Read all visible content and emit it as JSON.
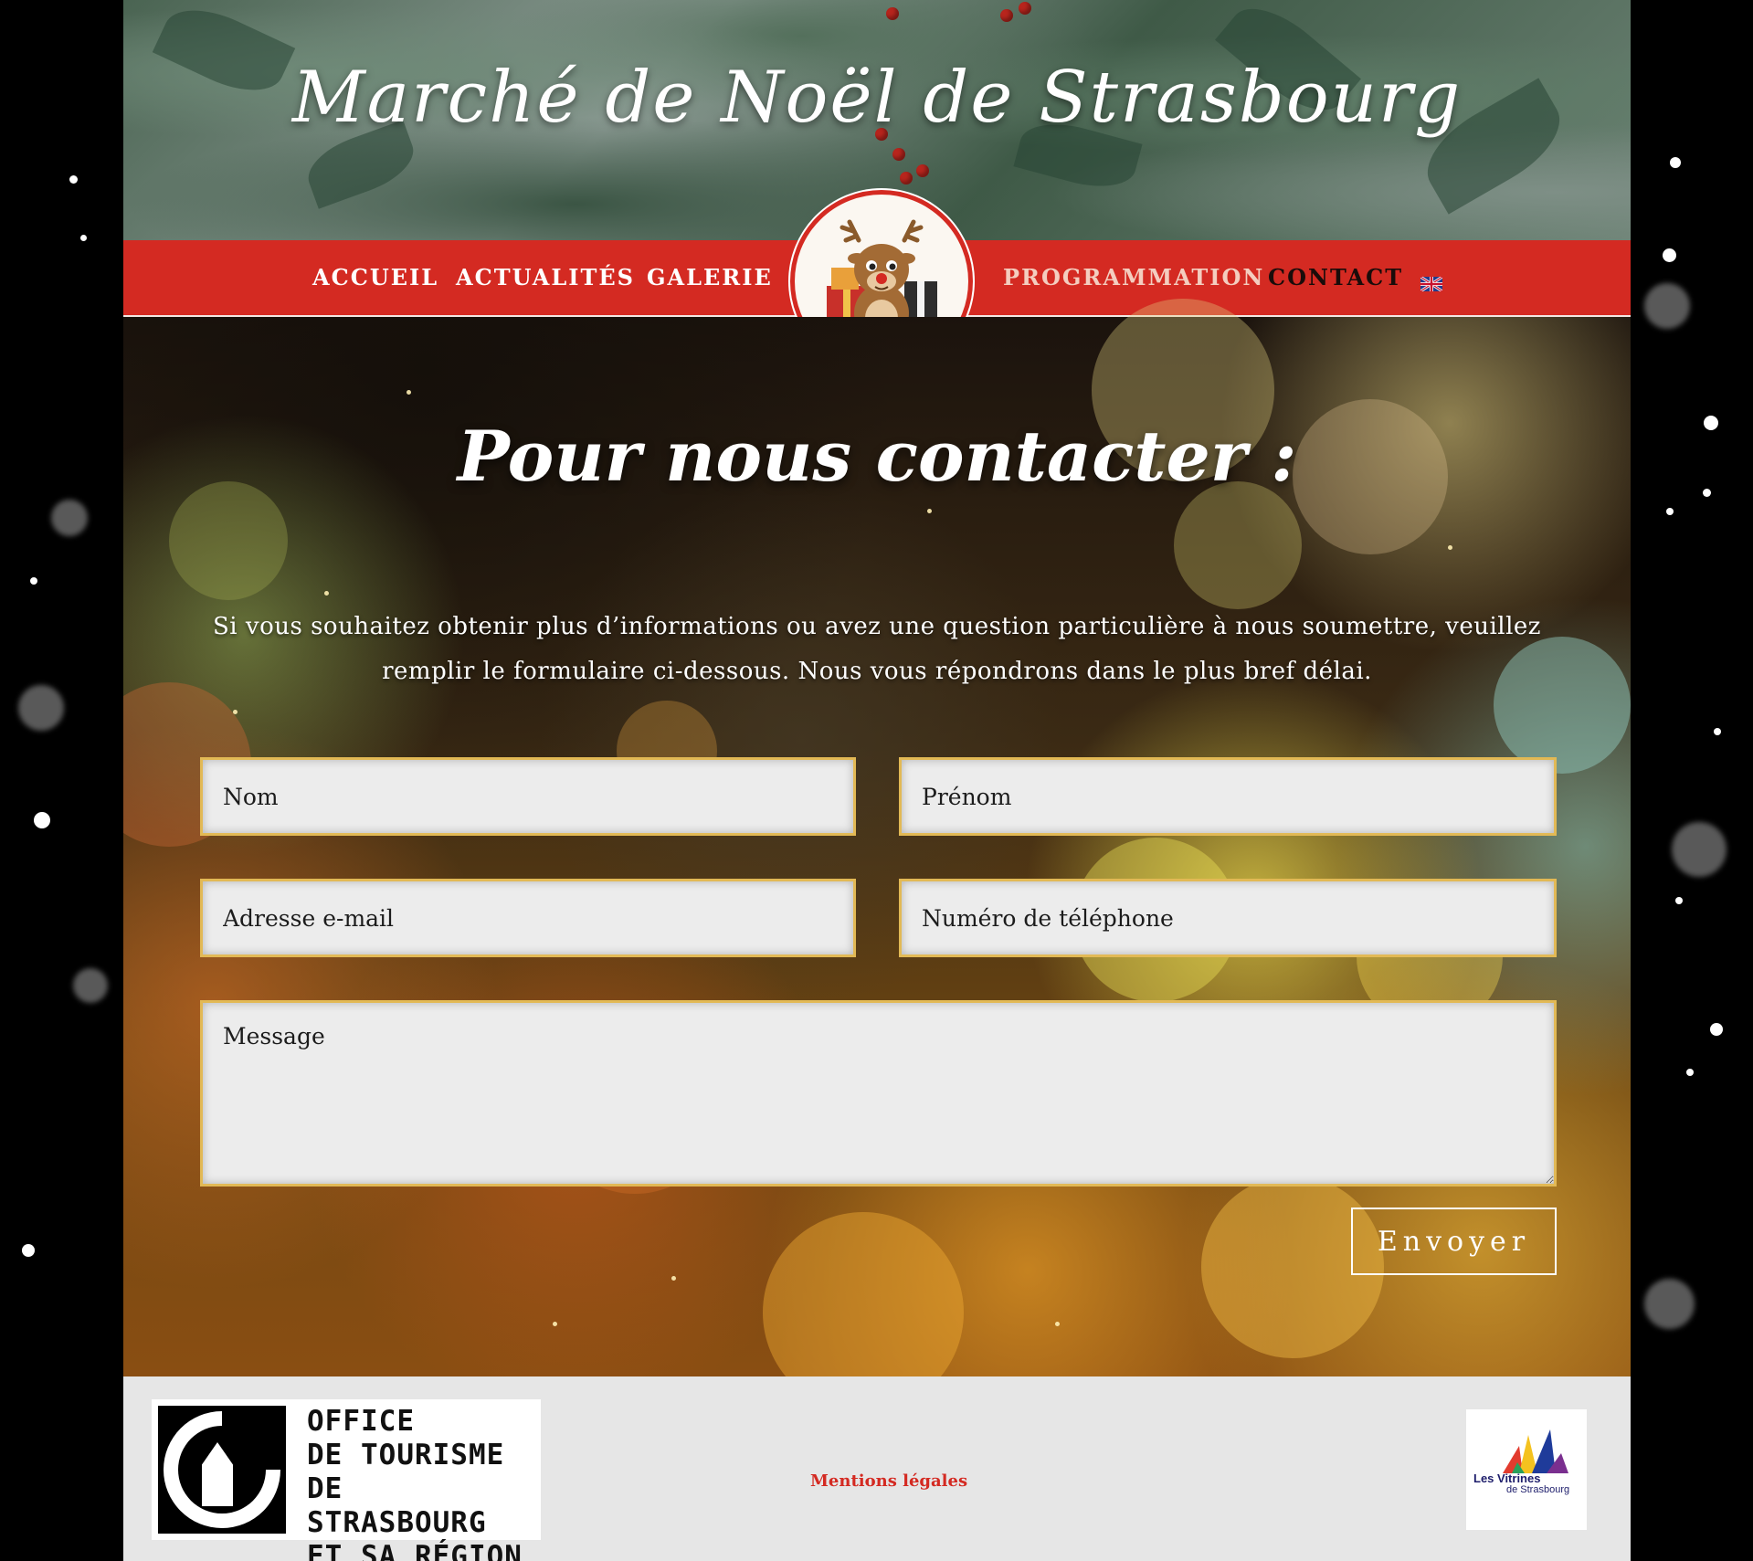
{
  "header": {
    "site_title": "Marché de Noël de Strasbourg",
    "nav": {
      "items": [
        {
          "label": "Accueil"
        },
        {
          "label": "Actualités"
        },
        {
          "label": "Galerie"
        },
        {
          "label": "Programmation"
        },
        {
          "label": "Contact"
        }
      ],
      "active": "Contact",
      "language_icon": "uk-flag-icon"
    },
    "logo_icon": "reindeer-with-gifts-icon"
  },
  "contact": {
    "title": "Pour nous contacter :",
    "intro": "Si vous souhaitez obtenir plus d’informations ou avez une question particulière à nous soumettre, veuillez remplir le formulaire ci-dessous. Nous vous répondrons dans le plus bref délai.",
    "form": {
      "last_name_placeholder": "Nom",
      "first_name_placeholder": "Prénom",
      "email_placeholder": "Adresse e-mail",
      "phone_placeholder": "Numéro de téléphone",
      "message_placeholder": "Message",
      "submit_label": "Envoyer"
    }
  },
  "footer": {
    "tourism_logo": {
      "lines": [
        "OFFICE",
        "DE TOURISME",
        "DE STRASBOURG",
        "ET SA RÉGION"
      ]
    },
    "legal_link": "Mentions légales",
    "vitrines_logo": {
      "name": "Les Vitrines",
      "sub": "de Strasbourg"
    }
  },
  "colors": {
    "nav_red": "#d42a22",
    "field_border_gold": "#e2b955",
    "footer_bg": "#e6e6e6"
  }
}
